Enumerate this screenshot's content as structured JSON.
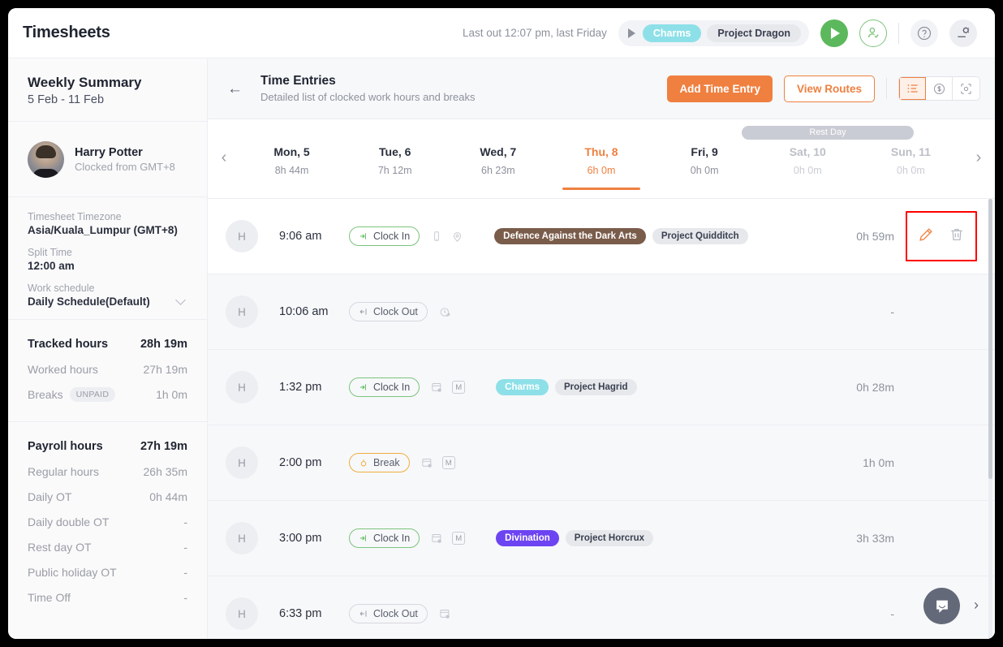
{
  "topbar": {
    "app_title": "Timesheets",
    "last_out": "Last out 12:07 pm, last Friday",
    "tracker_task": "Charms",
    "tracker_project": "Project Dragon",
    "play_icon": "play-icon",
    "start_icon": "play-circle-icon",
    "user_check_icon": "user-check-icon",
    "help_icon": "help-circle-icon",
    "settings_icon": "settings-icon"
  },
  "sidebar": {
    "summary_title": "Weekly Summary",
    "summary_range": "5 Feb - 11 Feb",
    "person_name": "Harry Potter",
    "person_sub": "Clocked from GMT+8",
    "meta": [
      {
        "label": "Timesheet Timezone",
        "value": "Asia/Kuala_Lumpur (GMT+8)"
      },
      {
        "label": "Split Time",
        "value": "12:00 am"
      },
      {
        "label": "Work schedule",
        "value": "Daily Schedule(Default)"
      }
    ],
    "tracked": [
      {
        "name": "Tracked hours",
        "value": "28h 19m",
        "head": true
      },
      {
        "name": "Worked hours",
        "value": "27h 19m",
        "head": false
      },
      {
        "name": "Breaks",
        "value": "1h 0m",
        "head": false,
        "badge": "UNPAID"
      }
    ],
    "payroll": [
      {
        "name": "Payroll hours",
        "value": "27h 19m",
        "head": true
      },
      {
        "name": "Regular hours",
        "value": "26h 35m",
        "head": false
      },
      {
        "name": "Daily OT",
        "value": "0h 44m",
        "head": false
      },
      {
        "name": "Daily double OT",
        "value": "-",
        "head": false
      },
      {
        "name": "Rest day OT",
        "value": "-",
        "head": false
      },
      {
        "name": "Public holiday OT",
        "value": "-",
        "head": false
      },
      {
        "name": "Time Off",
        "value": "-",
        "head": false
      }
    ]
  },
  "main": {
    "back_icon": "arrow-left-icon",
    "title": "Time Entries",
    "subtitle": "Detailed list of clocked work hours and breaks",
    "add_entry_label": "Add Time Entry",
    "view_routes_label": "View Routes",
    "view_modes": [
      {
        "icon": "list-view-icon",
        "active": true
      },
      {
        "icon": "dollar-view-icon",
        "active": false
      },
      {
        "icon": "location-scan-view-icon",
        "active": false
      }
    ]
  },
  "daystrip": {
    "rest_day_label": "Rest Day",
    "prev_icon": "chevron-left-icon",
    "next_icon": "chevron-right-icon",
    "days": [
      {
        "label": "Mon, 5",
        "hours": "8h 44m",
        "state": "normal"
      },
      {
        "label": "Tue, 6",
        "hours": "7h 12m",
        "state": "normal"
      },
      {
        "label": "Wed, 7",
        "hours": "6h 23m",
        "state": "normal"
      },
      {
        "label": "Thu, 8",
        "hours": "6h 0m",
        "state": "active"
      },
      {
        "label": "Fri, 9",
        "hours": "0h 0m",
        "state": "normal"
      },
      {
        "label": "Sat, 10",
        "hours": "0h 0m",
        "state": "muted"
      },
      {
        "label": "Sun, 11",
        "hours": "0h 0m",
        "state": "muted"
      }
    ]
  },
  "entries": [
    {
      "avatar_initial": "H",
      "time": "9:06 am",
      "state": "Clock In",
      "state_kind": "in",
      "icons": [
        "mobile-icon",
        "location-pin-icon"
      ],
      "tags": [
        {
          "label": "Defence Against the Dark Arts",
          "color": "#7a5c4b",
          "text_color": "#ffffff"
        },
        {
          "label": "Project Quidditch",
          "color": "#e6e8ec",
          "text_color": "#3b4050"
        }
      ],
      "duration": "0h 59m",
      "actions": {
        "edit_icon": "pencil-icon",
        "delete_icon": "trash-icon",
        "highlighted": true
      },
      "bg": "white"
    },
    {
      "avatar_initial": "H",
      "time": "10:06 am",
      "state": "Clock Out",
      "state_kind": "out",
      "icons": [
        "clock-edit-icon"
      ],
      "tags": [],
      "duration": "-",
      "actions": {
        "edit_icon": "pencil-icon",
        "delete_icon": "trash-icon",
        "highlighted": false
      },
      "bg": "tint"
    },
    {
      "avatar_initial": "H",
      "time": "1:32 pm",
      "state": "Clock In",
      "state_kind": "in",
      "icons": [
        "web-browser-icon",
        "m-badge-icon"
      ],
      "tags": [
        {
          "label": "Charms",
          "color": "#8ee0e8",
          "text_color": "#ffffff"
        },
        {
          "label": "Project Hagrid",
          "color": "#e6e8ec",
          "text_color": "#3b4050"
        }
      ],
      "duration": "0h 28m",
      "actions": {
        "edit_icon": "pencil-icon",
        "delete_icon": "trash-icon",
        "highlighted": false
      },
      "bg": "tint"
    },
    {
      "avatar_initial": "H",
      "time": "2:00 pm",
      "state": "Break",
      "state_kind": "break",
      "icons": [
        "web-browser-icon",
        "m-badge-icon"
      ],
      "tags": [],
      "duration": "1h 0m",
      "actions": {
        "edit_icon": "pencil-icon",
        "delete_icon": "trash-icon",
        "highlighted": false
      },
      "bg": "tint"
    },
    {
      "avatar_initial": "H",
      "time": "3:00 pm",
      "state": "Clock In",
      "state_kind": "in",
      "icons": [
        "web-browser-icon",
        "m-badge-icon"
      ],
      "tags": [
        {
          "label": "Divination",
          "color": "#6d44f2",
          "text_color": "#ffffff"
        },
        {
          "label": "Project Horcrux",
          "color": "#e6e8ec",
          "text_color": "#3b4050"
        }
      ],
      "duration": "3h 33m",
      "actions": {
        "edit_icon": "pencil-icon",
        "delete_icon": "trash-icon",
        "highlighted": false
      },
      "bg": "tint"
    },
    {
      "avatar_initial": "H",
      "time": "6:33 pm",
      "state": "Clock Out",
      "state_kind": "out",
      "icons": [
        "web-browser-icon"
      ],
      "tags": [],
      "duration": "-",
      "actions": {
        "edit_icon": "pencil-icon",
        "delete_icon": "trash-icon",
        "highlighted": false
      },
      "bg": "tint"
    }
  ],
  "chat": {
    "bubble_icon": "chat-bubble-icon",
    "chevron_icon": "chevron-right-icon"
  },
  "colors": {
    "accent": "#ef8040",
    "green": "#5cb85c",
    "cyan": "#8ee0e8",
    "purple": "#6d44f2",
    "brown": "#7a5c4b",
    "highlight": "#ff0000"
  }
}
